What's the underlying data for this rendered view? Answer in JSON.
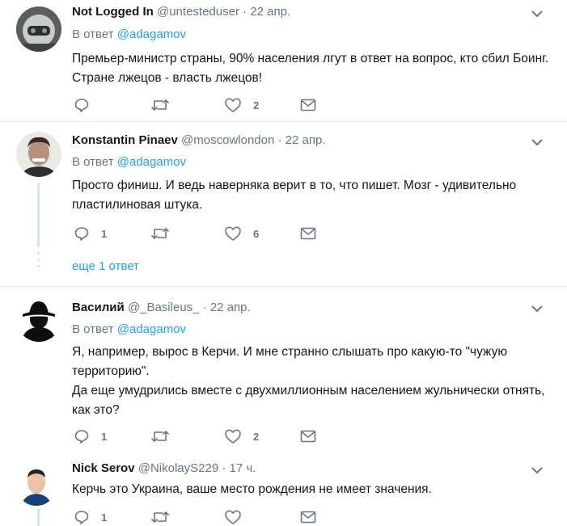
{
  "tweets": [
    {
      "name": "Not Logged In",
      "handle": "@untesteduser",
      "time": "22 апр.",
      "reply_prefix": "В ответ",
      "reply_to": "@adagamov",
      "text": "Премьер-министр страны, 90% населения лгут в ответ на вопрос, кто сбил Боинг. Стране лжецов - власть лжецов!",
      "replies": "",
      "retweets": "",
      "likes": "2"
    },
    {
      "name": "Konstantin Pinaev",
      "handle": "@moscowlondon",
      "time": "22 апр.",
      "reply_prefix": "В ответ",
      "reply_to": "@adagamov",
      "text": "Просто финиш. И ведь наверняка верит в то, что пишет. Мозг - удивительно пластилиновая штука.",
      "replies": "1",
      "retweets": "",
      "likes": "6",
      "more_replies": "еще 1 ответ"
    },
    {
      "name": "Василий",
      "handle": "@_Basileus_",
      "time": "22 апр.",
      "reply_prefix": "В ответ",
      "reply_to": "@adagamov",
      "text_line1": "Я, например, вырос в Керчи. И мне странно слышать про какую-то \"чужую территорию\".",
      "text_line2": "Да еще умудрились вместе с двухмиллионным населением жульнически отнять, как это?",
      "replies": "1",
      "retweets": "",
      "likes": "2"
    },
    {
      "name": "Nick Serov",
      "handle": "@NikolayS229",
      "time": "17 ч.",
      "text": "Керчь это Украина, ваше место рождения не имеет значения.",
      "replies": "1",
      "retweets": "",
      "likes": ""
    }
  ],
  "dot": "·",
  "colors": {
    "accent": "#1da1f2",
    "secondary_text": "#657786",
    "primary_text": "#14171a",
    "thread_line": "#cce6f7",
    "separator": "#e6ecf0"
  },
  "icons": [
    "reply-icon",
    "retweet-icon",
    "like-icon",
    "dm-icon",
    "chevron-down-icon"
  ]
}
